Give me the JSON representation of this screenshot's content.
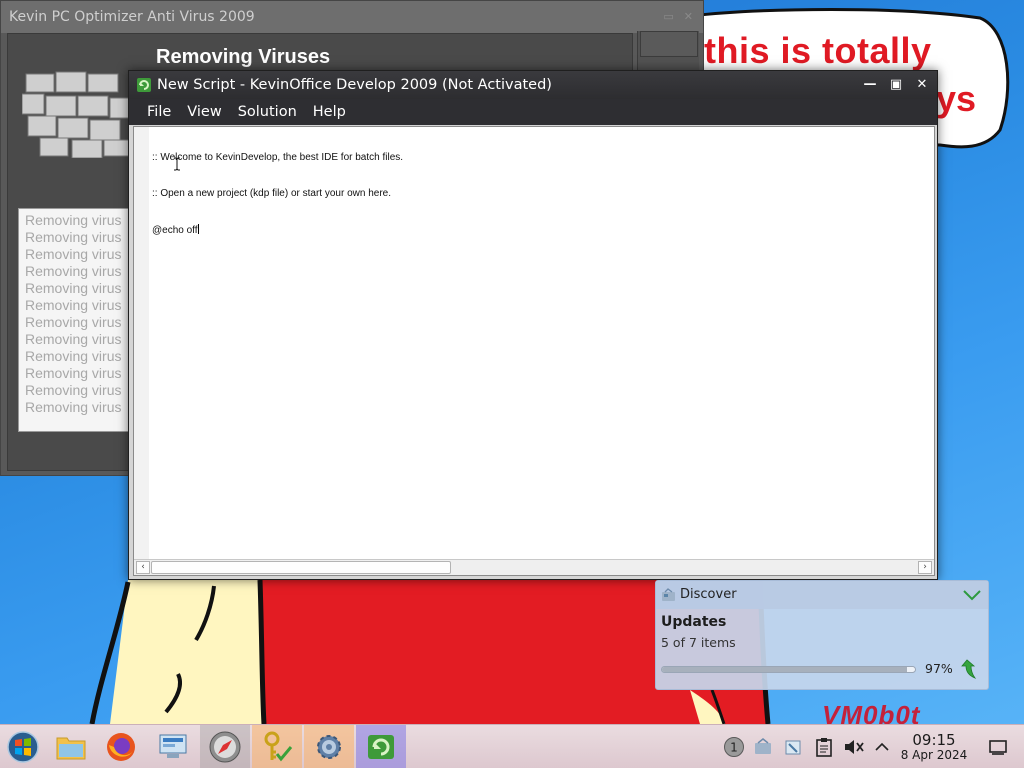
{
  "desktop": {
    "bubble_line1": "this is totally",
    "bubble_line2": "ys",
    "corner_logo": "VM0b0t"
  },
  "optimizer_window": {
    "title": "Kevin PC Optimizer Anti Virus 2009",
    "heading": "Removing Viruses",
    "log_lines": [
      "Removing virus",
      "Removing virus",
      "Removing virus",
      "Removing virus",
      "Removing virus",
      "Removing virus",
      "Removing virus",
      "Removing virus",
      "Removing virus",
      "Removing virus",
      "Removing virus",
      "Removing virus"
    ]
  },
  "editor_window": {
    "title": "New Script - KevinOffice Develop 2009 (Not Activated)",
    "menu": {
      "file": "File",
      "view": "View",
      "solution": "Solution",
      "help": "Help"
    },
    "code_lines": [
      ":: Welcome to KevinDevelop, the best IDE for batch files.",
      ":: Open a new project (kdp file) or start your own here.",
      "@echo off"
    ]
  },
  "notification": {
    "app": "Discover",
    "title": "Updates",
    "subtitle": "5 of 7 items",
    "progress_percent": 97,
    "progress_label": "97%"
  },
  "taskbar": {
    "apps": [
      "start-orb",
      "file-manager",
      "firefox",
      "control-panel",
      "safari-compass",
      "keys-app",
      "settings-gear",
      "kevin-office"
    ],
    "tray_badge": "1",
    "clock_time": "09:15",
    "clock_date": "8 Apr 2024"
  }
}
